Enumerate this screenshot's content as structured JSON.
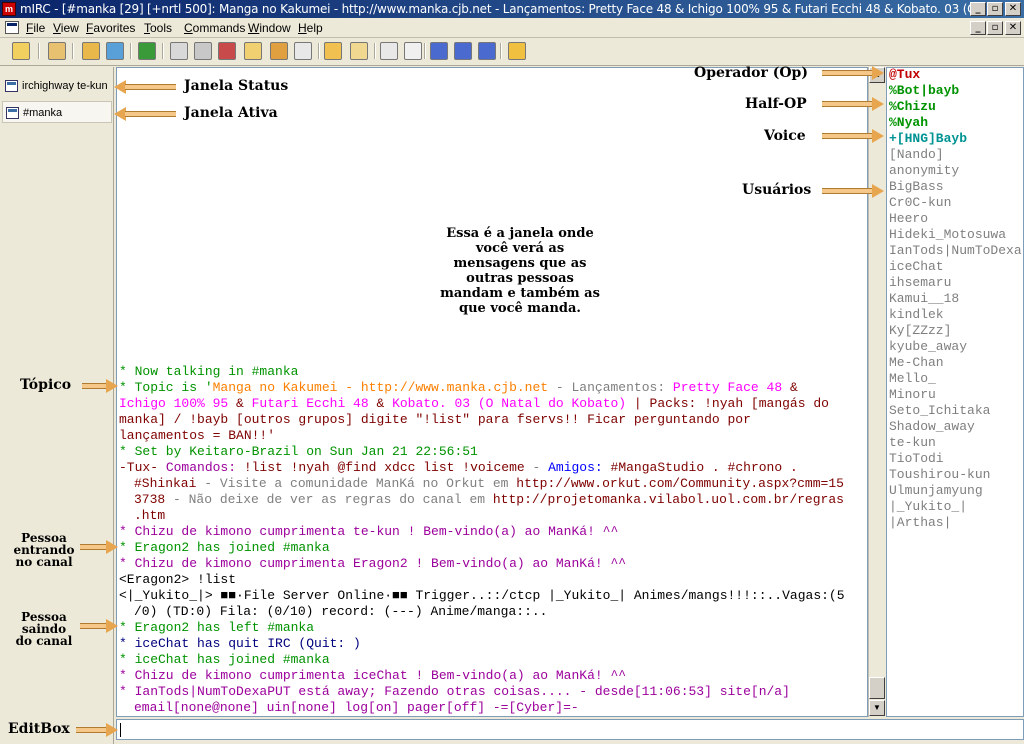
{
  "window": {
    "title": "mIRC - [#manka [29] [+nrtl 500]: Manga no Kakumei - http://www.manka.cjb.net - Lançamentos: Pretty Face 48 & Ichigo 100% 95 & Futari Ecchi 48 & Kobato. 03 (O ]",
    "minimize": "_",
    "maximize": "▫",
    "close": "✕"
  },
  "menu": {
    "items": [
      {
        "label": "File"
      },
      {
        "label": "View"
      },
      {
        "label": "Favorites"
      },
      {
        "label": "Tools"
      },
      {
        "label": "Commands"
      },
      {
        "label": "Window"
      },
      {
        "label": "Help"
      }
    ]
  },
  "switchbar": {
    "items": [
      {
        "label": "irchighway te-kun"
      },
      {
        "label": "#manka"
      }
    ]
  },
  "chat": {
    "description": "Essa é a janela onde você verá as mensagens que as outras pessoas mandam e também as que você manda."
  },
  "nicklist": {
    "nicks": [
      {
        "name": "@Tux",
        "role": "op"
      },
      {
        "name": "%Bot|bayb",
        "role": "halfop"
      },
      {
        "name": "%Chizu",
        "role": "halfop"
      },
      {
        "name": "%Nyah",
        "role": "halfop"
      },
      {
        "name": "+[HNG]Bayb",
        "role": "voice"
      },
      {
        "name": "[Nando]",
        "role": "user"
      },
      {
        "name": "anonymity",
        "role": "user"
      },
      {
        "name": "BigBass",
        "role": "user"
      },
      {
        "name": "Cr0C-kun",
        "role": "user"
      },
      {
        "name": "Heero",
        "role": "user"
      },
      {
        "name": "Hideki_Motosuwa",
        "role": "user"
      },
      {
        "name": "IanTods|NumToDexa",
        "role": "user"
      },
      {
        "name": "iceChat",
        "role": "user"
      },
      {
        "name": "ihsemaru",
        "role": "user"
      },
      {
        "name": "Kamui__18",
        "role": "user"
      },
      {
        "name": "kindlek",
        "role": "user"
      },
      {
        "name": "Ky[ZZzz]",
        "role": "user"
      },
      {
        "name": "kyube_away",
        "role": "user"
      },
      {
        "name": "Me-Chan",
        "role": "user"
      },
      {
        "name": "Mello_",
        "role": "user"
      },
      {
        "name": "Minoru",
        "role": "user"
      },
      {
        "name": "Seto_Ichitaka",
        "role": "user"
      },
      {
        "name": "Shadow_away",
        "role": "user"
      },
      {
        "name": "te-kun",
        "role": "user"
      },
      {
        "name": "TioTodi",
        "role": "user"
      },
      {
        "name": "Toushirou-kun",
        "role": "user"
      },
      {
        "name": "Ulmunjamyung",
        "role": "user"
      },
      {
        "name": "|_Yukito_|",
        "role": "user"
      },
      {
        "name": "|Arthas|",
        "role": "user"
      }
    ]
  },
  "annotations": {
    "status": "Janela Status",
    "active": "Janela Ativa",
    "operator": "Operador (Op)",
    "halfop": "Half-OP",
    "voice": "Voice",
    "users": "Usuários",
    "topic": "Tópico",
    "joining": "Pessoa entrando no canal",
    "leaving": "Pessoa saindo do canal",
    "editbox": "EditBox"
  },
  "messages": {
    "l1": "* Now talking in #manka",
    "l2a": "* Topic is '",
    "l2b": "Manga no Kakumei - http://www.manka.cjb.net",
    "l2c": " - ",
    "l2d": "Lançamentos: ",
    "l2e": "Pretty Face 48",
    "l2f": " &",
    "l3a": "Ichigo 100% 95",
    "l3b": " & ",
    "l3c": "Futari Ecchi 48",
    "l3d": " & ",
    "l3e": "Kobato. 03 (O Natal do Kobato)",
    "l3f": " | Packs: !nyah [mangás do",
    "l4": "manka] / !bayb [outros grupos] digite \"!list\" para fservs!! Ficar perguntando por",
    "l5": "lançamentos = BAN!!'",
    "l6": "* Set by Keitaro-Brazil on Sun Jan 21 22:56:51",
    "l7a": "-Tux- ",
    "l7b": "Comandos: ",
    "l7c": "!list !nyah @find xdcc list !voiceme",
    "l7d": " - ",
    "l7e": "Amigos: ",
    "l7f": "#MangaStudio . #chrono .",
    "l8a": "#Shinkai",
    "l8b": " - Visite a comunidade ManKá no Orkut em ",
    "l8c": "http://www.orkut.com/Community.aspx?cmm=15",
    "l9a": "3738",
    "l9b": " - Não deixe de ver as regras do canal em ",
    "l9c": "http://projetomanka.vilabol.uol.com.br/regras",
    "l10": ".htm",
    "l11": "* Chizu de kimono cumprimenta te-kun ! Bem-vindo(a) ao ManKá! ^^",
    "l12": "* Eragon2 has joined #manka",
    "l13": "* Chizu de kimono cumprimenta Eragon2 ! Bem-vindo(a) ao ManKá! ^^",
    "l14": "<Eragon2> !list",
    "l15": "<|_Yukito_|> ■■·File Server Online·■■ Trigger..::/ctcp |_Yukito_| Animes/mangs!!!::..Vagas:(5",
    "l16": "/0) (TD:0) Fila: (0/10) record: (---) Anime/manga::..",
    "l17": "* Eragon2 has left #manka",
    "l18": "* iceChat has quit IRC (Quit: )",
    "l19": "* iceChat has joined #manka",
    "l20": "* Chizu de kimono cumprimenta iceChat ! Bem-vindo(a) ao ManKá! ^^",
    "l21": "* IanTods|NumToDexaPUT está away; Fazendo otras coisas.... - desde[11:06:53] site[n/a]",
    "l22": "email[none@none] uin[none] log[on] pager[off] -=[Cyber]=-"
  }
}
